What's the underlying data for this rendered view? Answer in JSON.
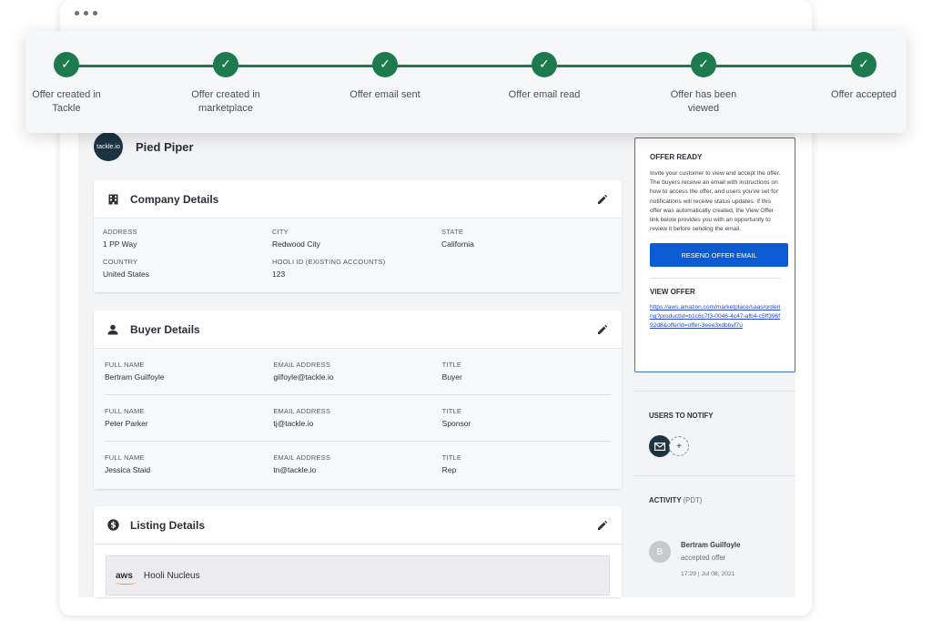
{
  "progress": {
    "steps": [
      {
        "label_line1": "Offer created in",
        "label_line2": "Tackle"
      },
      {
        "label_line1": "Offer created in",
        "label_line2": "marketplace"
      },
      {
        "label_line1": "Offer email sent",
        "label_line2": ""
      },
      {
        "label_line1": "Offer email read",
        "label_line2": ""
      },
      {
        "label_line1": "Offer has been",
        "label_line2": "viewed"
      },
      {
        "label_line1": "Offer accepted",
        "label_line2": ""
      }
    ],
    "check_glyph": "✓",
    "color": "#1d7a4f"
  },
  "account": {
    "logo_text": "tackle.io",
    "name": "Pied Piper"
  },
  "company": {
    "title": "Company Details",
    "icon": "building-icon",
    "fields": {
      "address_label": "ADDRESS",
      "address": "1 PP Way",
      "city_label": "CITY",
      "city": "Redwood City",
      "state_label": "STATE",
      "state": "California",
      "country_label": "COUNTRY",
      "country": "United States",
      "hooli_label": "HOOLI ID (EXISTING ACCOUNTS)",
      "hooli": "123"
    }
  },
  "buyer": {
    "title": "Buyer Details",
    "icon": "person-icon",
    "labels": {
      "name": "FULL NAME",
      "email": "EMAIL ADDRESS",
      "title": "TITLE"
    },
    "rows": [
      {
        "name": "Bertram Guilfoyle",
        "email": "gilfoyle@tackle.io",
        "title": "Buyer"
      },
      {
        "name": "Peter Parker",
        "email": "tj@tackle.io",
        "title": "Sponsor"
      },
      {
        "name": "Jessica Staid",
        "email": "tn@tackle.io",
        "title": "Rep"
      }
    ]
  },
  "listing": {
    "title": "Listing Details",
    "icon": "dollar-icon",
    "vendor": "aws",
    "product": "Hooli Nucleus"
  },
  "offer_ready": {
    "heading": "OFFER READY",
    "description": "Invite your customer to view and accept the offer. The buyers receive an email with instructions on how to access the offer, and users you've set for notifications will receive status updates. If this offer was automatically created, the View Offer link below provides you with an opportunity to review it before sending the email.",
    "button": "RESEND OFFER EMAIL",
    "view_heading": "VIEW OFFER",
    "view_link": "https://aws.amazon.com/marketplace/saas/ordering?productId=b1c6c7f3-0046-4c47-afb4-c5ff396f92d8&offerId=offer-3eee3xdbbvf7u"
  },
  "notify": {
    "heading": "USERS TO NOTIFY",
    "add_glyph": "+"
  },
  "activity": {
    "heading": "ACTIVITY",
    "tz": "(PDT)",
    "items": [
      {
        "initial": "B",
        "who": "Bertram Guilfoyle",
        "what": "accepted offer",
        "when": "17:29 | Jul 08, 2021"
      }
    ]
  },
  "colors": {
    "accent": "#0b5bd3",
    "success": "#1d7a4f",
    "navy": "#1c3442"
  }
}
